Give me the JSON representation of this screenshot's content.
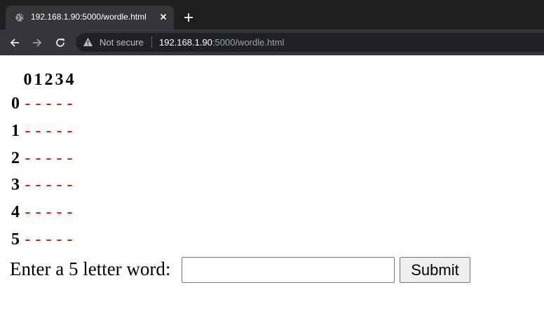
{
  "browser": {
    "tab": {
      "title": "192.168.1.90:5000/wordle.html",
      "favicon": "globe-icon"
    },
    "security_label": "Not secure",
    "url": {
      "host": "192.168.1.90",
      "rest": ":5000/wordle.html"
    },
    "colors": {
      "tabstrip": "#1e1e1e",
      "toolbar": "#35363a",
      "omnibox": "#202124"
    }
  },
  "board": {
    "columns": [
      "0",
      "1",
      "2",
      "3",
      "4"
    ],
    "rows": [
      {
        "label": "0",
        "cells": [
          "-",
          "-",
          "-",
          "-",
          "-"
        ]
      },
      {
        "label": "1",
        "cells": [
          "-",
          "-",
          "-",
          "-",
          "-"
        ]
      },
      {
        "label": "2",
        "cells": [
          "-",
          "-",
          "-",
          "-",
          "-"
        ]
      },
      {
        "label": "3",
        "cells": [
          "-",
          "-",
          "-",
          "-",
          "-"
        ]
      },
      {
        "label": "4",
        "cells": [
          "-",
          "-",
          "-",
          "-",
          "-"
        ]
      },
      {
        "label": "5",
        "cells": [
          "-",
          "-",
          "-",
          "-",
          "-"
        ]
      }
    ],
    "cell_color": "#e00000"
  },
  "form": {
    "label": "Enter a 5 letter word:",
    "input_value": "",
    "submit_label": "Submit"
  }
}
